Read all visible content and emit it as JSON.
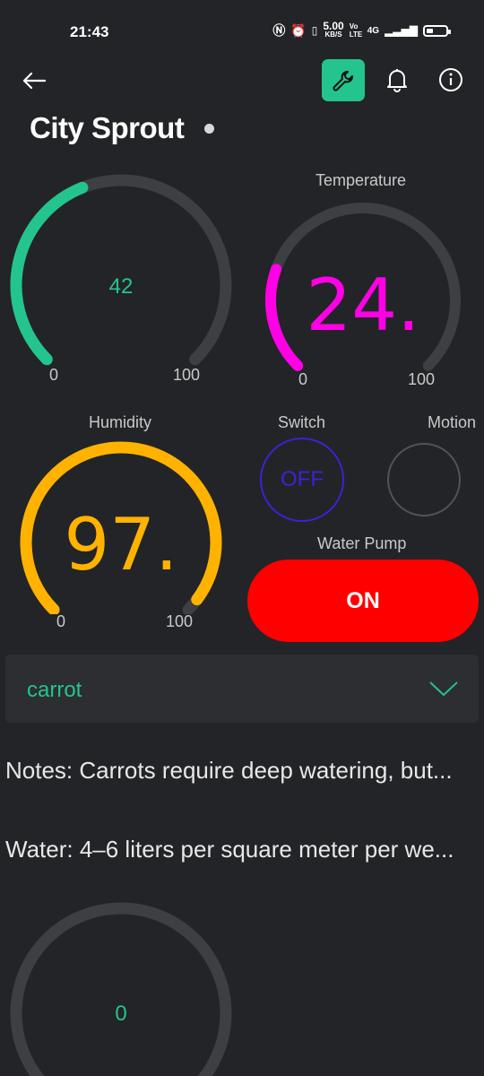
{
  "status_bar": {
    "time": "21:43",
    "speed_value": "5.00",
    "speed_unit": "KB/S",
    "volte": "Vo LTE",
    "network": "4G",
    "battery_level": 0.35
  },
  "header": {
    "title": "City Sprout"
  },
  "gauge_main": {
    "value": "42",
    "min": "0",
    "max": "100",
    "fraction": 0.42,
    "color": "#23c48e"
  },
  "temperature": {
    "label": "Temperature",
    "value": "24.",
    "min": "0",
    "max": "100",
    "fraction": 0.24,
    "color": "#ff00e6"
  },
  "humidity": {
    "label": "Humidity",
    "value": "97.",
    "min": "0",
    "max": "100",
    "fraction": 0.97,
    "color": "#ffb300"
  },
  "switch": {
    "label": "Switch",
    "state": "OFF",
    "color": "#3b22d6"
  },
  "motion": {
    "label": "Motion"
  },
  "water_pump": {
    "label": "Water Pump",
    "state": "ON",
    "color": "#ff0000"
  },
  "plant_select": {
    "value": "carrot"
  },
  "notes": "Notes: Carrots require deep watering, but...",
  "water": "Water: 4–6 liters per square meter per we...",
  "gauge_bottom": {
    "value": "0",
    "fraction": 0.0,
    "color": "#23c48e"
  },
  "colors": {
    "background": "#232427",
    "accent": "#23c48e",
    "track": "#3e3f42"
  }
}
